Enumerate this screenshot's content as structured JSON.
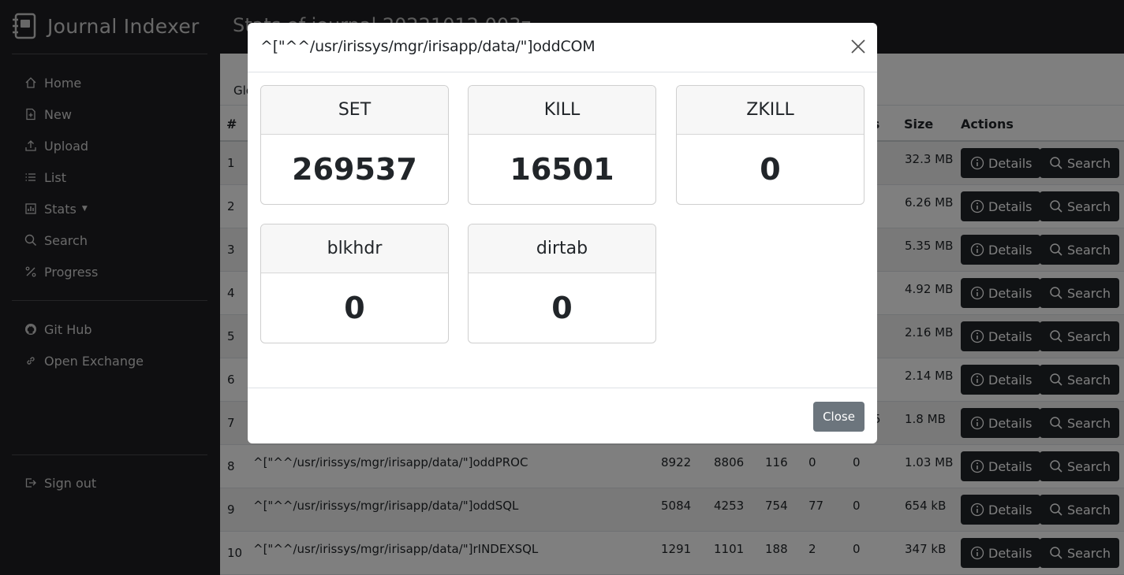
{
  "app": {
    "title": "Journal Indexer"
  },
  "sidebar": {
    "items": [
      {
        "label": "Home",
        "icon": "house-icon"
      },
      {
        "label": "New",
        "icon": "file-plus-icon"
      },
      {
        "label": "Upload",
        "icon": "upload-icon"
      },
      {
        "label": "List",
        "icon": "list-icon"
      },
      {
        "label": "Stats",
        "icon": "bar-chart-icon"
      },
      {
        "label": "Search",
        "icon": "search-icon"
      },
      {
        "label": "Progress",
        "icon": "percent-icon"
      }
    ],
    "links": [
      {
        "label": "Git Hub",
        "icon": "github-icon"
      },
      {
        "label": "Open Exchange",
        "icon": "link-icon"
      }
    ],
    "signout": {
      "label": "Sign out",
      "icon": "signout-icon"
    }
  },
  "header": {
    "title": "Stats of journal 20221012.003z"
  },
  "main": {
    "tab_label": "Glo",
    "columns": {
      "num": "#",
      "users": "ers",
      "size": "Size",
      "actions": "Actions"
    },
    "details_label": "Details",
    "search_label": "Search",
    "rows": [
      {
        "num": "1",
        "size": "32.3 MB"
      },
      {
        "num": "2",
        "size": "6.26 MB"
      },
      {
        "num": "3",
        "size": "5.35 MB"
      },
      {
        "num": "4",
        "size": "4.92 MB"
      },
      {
        "num": "5",
        "size": "2.16 MB"
      },
      {
        "num": "6",
        "size": "2.14 MB"
      },
      {
        "num": "7",
        "users": "5",
        "size": "1.8 MB"
      },
      {
        "num": "8",
        "global": "^[\"^^/usr/irissys/mgr/irisapp/data/\"]oddPROC",
        "total": "8922",
        "set": "8806",
        "kill": "116",
        "zkill": "0",
        "other": "0",
        "size": "1.03 MB"
      },
      {
        "num": "9",
        "global": "^[\"^^/usr/irissys/mgr/irisapp/data/\"]oddSQL",
        "total": "5084",
        "set": "4253",
        "kill": "754",
        "zkill": "77",
        "other": "0",
        "size": "654 kB"
      },
      {
        "num": "10",
        "global": "^[\"^^/usr/irissys/mgr/irisapp/data/\"]rINDEXSQL",
        "total": "1291",
        "set": "1101",
        "kill": "188",
        "zkill": "2",
        "other": "0",
        "size": "347 kB"
      }
    ]
  },
  "modal": {
    "title": "^[\"^^/usr/irissys/mgr/irisapp/data/\"]oddCOM",
    "stats": [
      {
        "label": "SET",
        "value": "269537"
      },
      {
        "label": "KILL",
        "value": "16501"
      },
      {
        "label": "ZKILL",
        "value": "0"
      },
      {
        "label": "blkhdr",
        "value": "0"
      },
      {
        "label": "dirtab",
        "value": "0"
      }
    ],
    "close_label": "Close"
  }
}
